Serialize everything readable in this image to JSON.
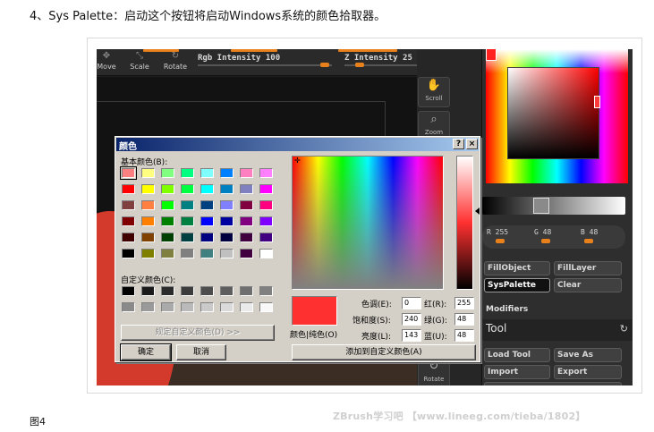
{
  "article": {
    "heading": "4、Sys Palette：启动这个按钮将启动Windows系统的颜色拾取器。",
    "figure_caption": "图4",
    "watermark": "ZBrush学习吧 【www.lineeg.com/tieba/1802】"
  },
  "zbrush": {
    "toolbar": [
      {
        "label": "Move",
        "icon": "move-icon"
      },
      {
        "label": "Scale",
        "icon": "scale-icon"
      },
      {
        "label": "Rotate",
        "icon": "rotate-icon"
      }
    ],
    "rgb_intensity_label": "Rgb Intensity 100",
    "rgb_intensity": 100,
    "z_intensity_label": "Z Intensity 25",
    "z_intensity": 25,
    "shelf": [
      {
        "label": "Scroll",
        "icon": "scroll-hand-icon"
      },
      {
        "label": "Zoom",
        "icon": "zoom-icon"
      },
      {
        "label": "Rotate",
        "icon": "rotate-icon"
      }
    ],
    "color_panel": {
      "r_label": "R 255",
      "g_label": "G 48",
      "b_label": "B 48",
      "r": 255,
      "g": 48,
      "b": 48,
      "buttons": {
        "fill_object": "FillObject",
        "fill_layer": "FillLayer",
        "sys_palette": "SysPalette",
        "clear": "Clear"
      },
      "modifiers_label": "Modifiers"
    },
    "tool_panel": {
      "title": "Tool",
      "load_tool": "Load Tool",
      "save_as": "Save As",
      "import": "Import",
      "export": "Export"
    }
  },
  "color_dialog": {
    "title": "颜色",
    "help_button": "?",
    "close_button": "×",
    "basic_colors_label": "基本颜色(B):",
    "basic_colors": [
      [
        "#ff8080",
        "#ffff80",
        "#80ff80",
        "#00ff80",
        "#80ffff",
        "#0080ff",
        "#ff80c0",
        "#ff80ff"
      ],
      [
        "#ff0000",
        "#ffff00",
        "#80ff00",
        "#00ff40",
        "#00ffff",
        "#0080c0",
        "#8080c0",
        "#ff00ff"
      ],
      [
        "#804040",
        "#ff8040",
        "#00ff00",
        "#008080",
        "#004080",
        "#8080ff",
        "#800040",
        "#ff0080"
      ],
      [
        "#800000",
        "#ff8000",
        "#008000",
        "#008040",
        "#0000ff",
        "#0000a0",
        "#800080",
        "#8000ff"
      ],
      [
        "#400000",
        "#804000",
        "#004000",
        "#004040",
        "#000080",
        "#000040",
        "#400040",
        "#400080"
      ],
      [
        "#000000",
        "#808000",
        "#808040",
        "#808080",
        "#408080",
        "#c0c0c0",
        "#400040",
        "#ffffff"
      ]
    ],
    "custom_colors_label": "自定义颜色(C):",
    "custom_colors": [
      [
        "#000000",
        "#1a1a1a",
        "#2b2b2b",
        "#3c3c3c",
        "#4d4d4d",
        "#5e5e5e",
        "#6f6f6f",
        "#808080"
      ],
      [
        "#8a8a8a",
        "#9a9a9a",
        "#aaaaaa",
        "#bababa",
        "#cacaca",
        "#dadada",
        "#eaeaea",
        "#f8f8f8"
      ]
    ],
    "define_custom_button": "规定自定义颜色(D) >>",
    "ok_button": "确定",
    "cancel_button": "取消",
    "color_solid_label": "颜色|纯色(O)",
    "fields": {
      "hue_label": "色调(E):",
      "hue": "0",
      "sat_label": "饱和度(S):",
      "sat": "240",
      "lum_label": "亮度(L):",
      "lum": "143",
      "red_label": "红(R):",
      "red": "255",
      "green_label": "绿(G):",
      "green": "48",
      "blue_label": "蓝(U):",
      "blue": "48"
    },
    "add_custom_button": "添加到自定义颜色(A)",
    "current_color": "#ff3030"
  }
}
